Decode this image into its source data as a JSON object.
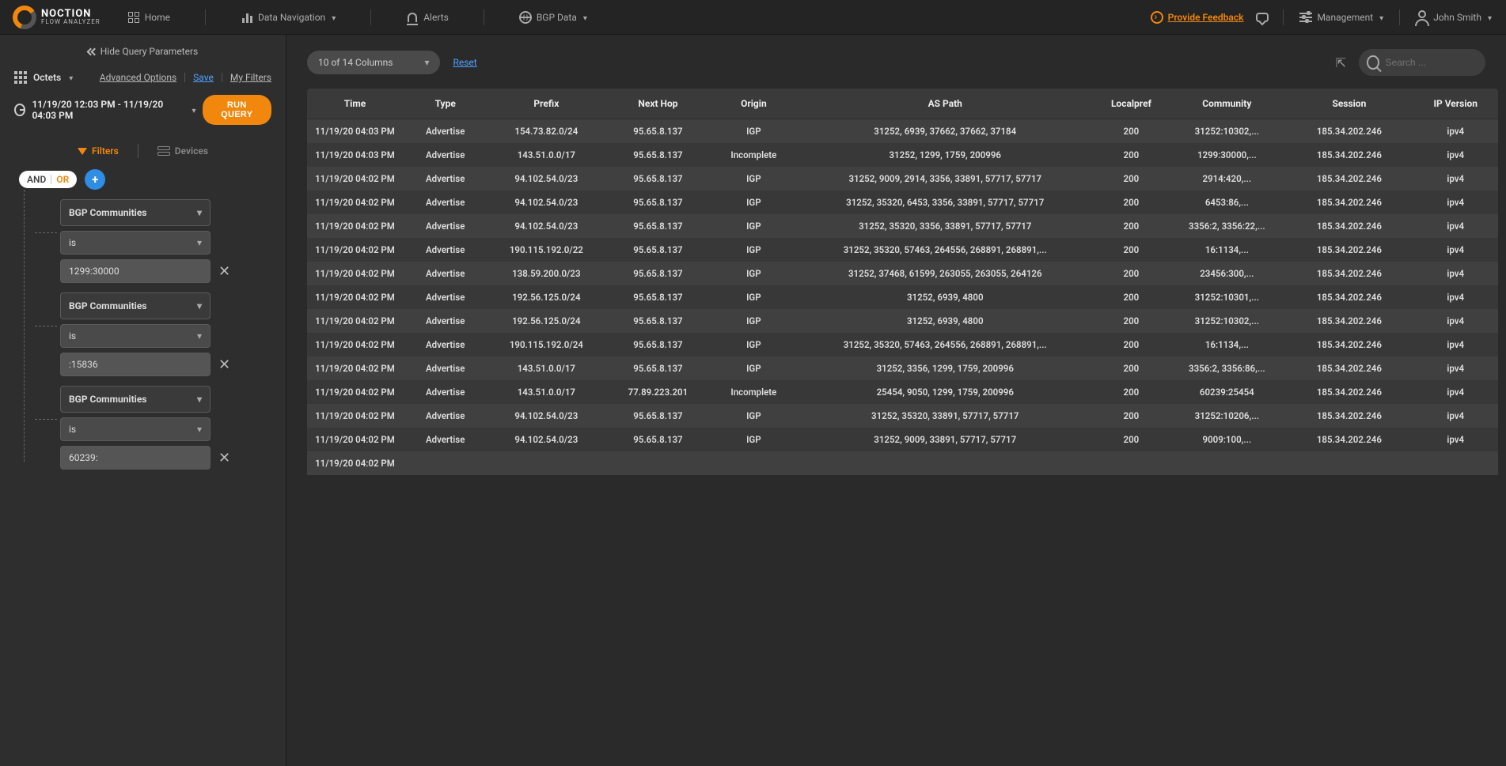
{
  "brand": {
    "name": "NOCTION",
    "sub": "FLOW ANALYZER"
  },
  "nav": {
    "home": "Home",
    "dataNav": "Data Navigation",
    "alerts": "Alerts",
    "bgp": "BGP Data",
    "feedback": "Provide Feedback",
    "management": "Management",
    "user": "John Smith"
  },
  "sidebar": {
    "hideQP": "Hide Query Parameters",
    "octets": "Octets",
    "advanced": "Advanced Options",
    "save": "Save",
    "myFilters": "My Filters",
    "timerange": "11/19/20 12:03 PM - 11/19/20 04:03 PM",
    "runQuery": "RUN QUERY",
    "tabs": {
      "filters": "Filters",
      "devices": "Devices"
    },
    "mode": {
      "and": "AND",
      "or": "OR"
    },
    "filterGroups": [
      {
        "field": "BGP Communities",
        "op": "is",
        "value": "1299:30000"
      },
      {
        "field": "BGP Communities",
        "op": "is",
        "value": ":15836"
      },
      {
        "field": "BGP Communities",
        "op": "is",
        "value": "60239:"
      }
    ]
  },
  "toolbar": {
    "columnsLabel": "10 of 14 Columns",
    "reset": "Reset",
    "searchPlaceholder": "Search ..."
  },
  "table": {
    "headers": [
      "Time",
      "Type",
      "Prefix",
      "Next Hop",
      "Origin",
      "AS Path",
      "Localpref",
      "Community",
      "Session",
      "IP Version"
    ],
    "rows": [
      [
        "11/19/20 04:03 PM",
        "Advertise",
        "154.73.82.0/24",
        "95.65.8.137",
        "IGP",
        "31252, 6939, 37662, 37662, 37184",
        "200",
        "31252:10302,...",
        "185.34.202.246",
        "ipv4"
      ],
      [
        "11/19/20 04:03 PM",
        "Advertise",
        "143.51.0.0/17",
        "95.65.8.137",
        "Incomplete",
        "31252, 1299, 1759, 200996",
        "200",
        "1299:30000,...",
        "185.34.202.246",
        "ipv4"
      ],
      [
        "11/19/20 04:02 PM",
        "Advertise",
        "94.102.54.0/23",
        "95.65.8.137",
        "IGP",
        "31252, 9009, 2914, 3356, 33891, 57717, 57717",
        "200",
        "2914:420,...",
        "185.34.202.246",
        "ipv4"
      ],
      [
        "11/19/20 04:02 PM",
        "Advertise",
        "94.102.54.0/23",
        "95.65.8.137",
        "IGP",
        "31252, 35320, 6453, 3356, 33891, 57717, 57717",
        "200",
        "6453:86,...",
        "185.34.202.246",
        "ipv4"
      ],
      [
        "11/19/20 04:02 PM",
        "Advertise",
        "94.102.54.0/23",
        "95.65.8.137",
        "IGP",
        "31252, 35320, 3356, 33891, 57717, 57717",
        "200",
        "3356:2, 3356:22,...",
        "185.34.202.246",
        "ipv4"
      ],
      [
        "11/19/20 04:02 PM",
        "Advertise",
        "190.115.192.0/22",
        "95.65.8.137",
        "IGP",
        "31252, 35320, 57463, 264556, 268891, 268891,...",
        "200",
        "16:1134,...",
        "185.34.202.246",
        "ipv4"
      ],
      [
        "11/19/20 04:02 PM",
        "Advertise",
        "138.59.200.0/23",
        "95.65.8.137",
        "IGP",
        "31252, 37468, 61599, 263055, 263055, 264126",
        "200",
        "23456:300,...",
        "185.34.202.246",
        "ipv4"
      ],
      [
        "11/19/20 04:02 PM",
        "Advertise",
        "192.56.125.0/24",
        "95.65.8.137",
        "IGP",
        "31252, 6939, 4800",
        "200",
        "31252:10301,...",
        "185.34.202.246",
        "ipv4"
      ],
      [
        "11/19/20 04:02 PM",
        "Advertise",
        "192.56.125.0/24",
        "95.65.8.137",
        "IGP",
        "31252, 6939, 4800",
        "200",
        "31252:10302,...",
        "185.34.202.246",
        "ipv4"
      ],
      [
        "11/19/20 04:02 PM",
        "Advertise",
        "190.115.192.0/24",
        "95.65.8.137",
        "IGP",
        "31252, 35320, 57463, 264556, 268891, 268891,...",
        "200",
        "16:1134,...",
        "185.34.202.246",
        "ipv4"
      ],
      [
        "11/19/20 04:02 PM",
        "Advertise",
        "143.51.0.0/17",
        "95.65.8.137",
        "IGP",
        "31252, 3356, 1299, 1759, 200996",
        "200",
        "3356:2, 3356:86,...",
        "185.34.202.246",
        "ipv4"
      ],
      [
        "11/19/20 04:02 PM",
        "Advertise",
        "143.51.0.0/17",
        "77.89.223.201",
        "Incomplete",
        "25454, 9050, 1299, 1759, 200996",
        "200",
        "60239:25454",
        "185.34.202.246",
        "ipv4"
      ],
      [
        "11/19/20 04:02 PM",
        "Advertise",
        "94.102.54.0/23",
        "95.65.8.137",
        "IGP",
        "31252, 35320, 33891, 57717, 57717",
        "200",
        "31252:10206,...",
        "185.34.202.246",
        "ipv4"
      ],
      [
        "11/19/20 04:02 PM",
        "Advertise",
        "94.102.54.0/23",
        "95.65.8.137",
        "IGP",
        "31252, 9009, 33891, 57717, 57717",
        "200",
        "9009:100,...",
        "185.34.202.246",
        "ipv4"
      ],
      [
        "11/19/20 04:02 PM",
        "",
        "",
        "",
        "",
        "",
        "",
        "",
        "",
        ""
      ]
    ]
  }
}
